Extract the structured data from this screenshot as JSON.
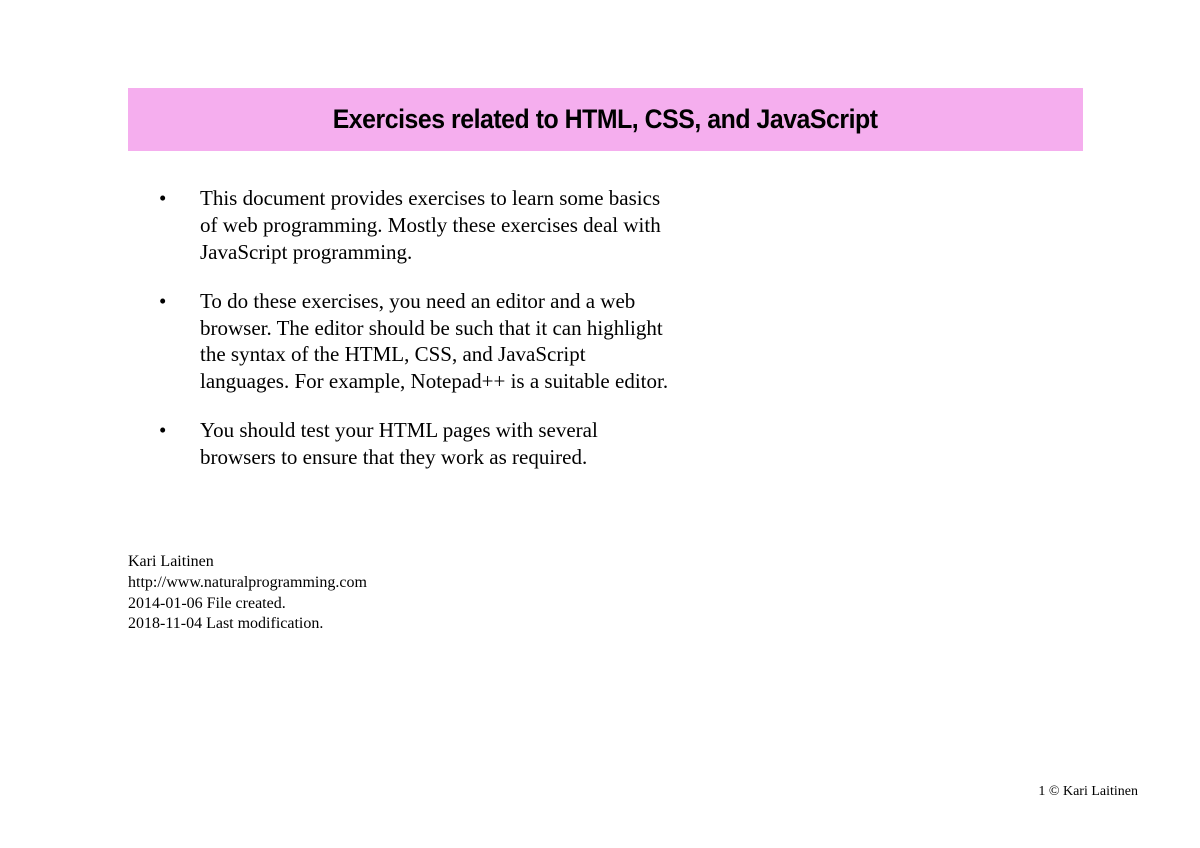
{
  "title": "Exercises related to HTML, CSS, and JavaScript",
  "bullets": [
    "This document provides exercises to learn some basics of web programming. Mostly these exercises deal with JavaScript programming.",
    "To do these exercises, you need an editor and a web browser. The editor should be such that it can highlight the syntax of the HTML, CSS, and JavaScript languages. For example, Notepad++ is a suitable editor.",
    "You should test your HTML pages with several browsers to ensure that they work as required."
  ],
  "meta": {
    "author": "Kari Laitinen",
    "url": "http://www.naturalprogramming.com",
    "created": "2014-01-06 File created.",
    "modified": "2018-11-04 Last modification."
  },
  "footer": "1  © Kari Laitinen"
}
